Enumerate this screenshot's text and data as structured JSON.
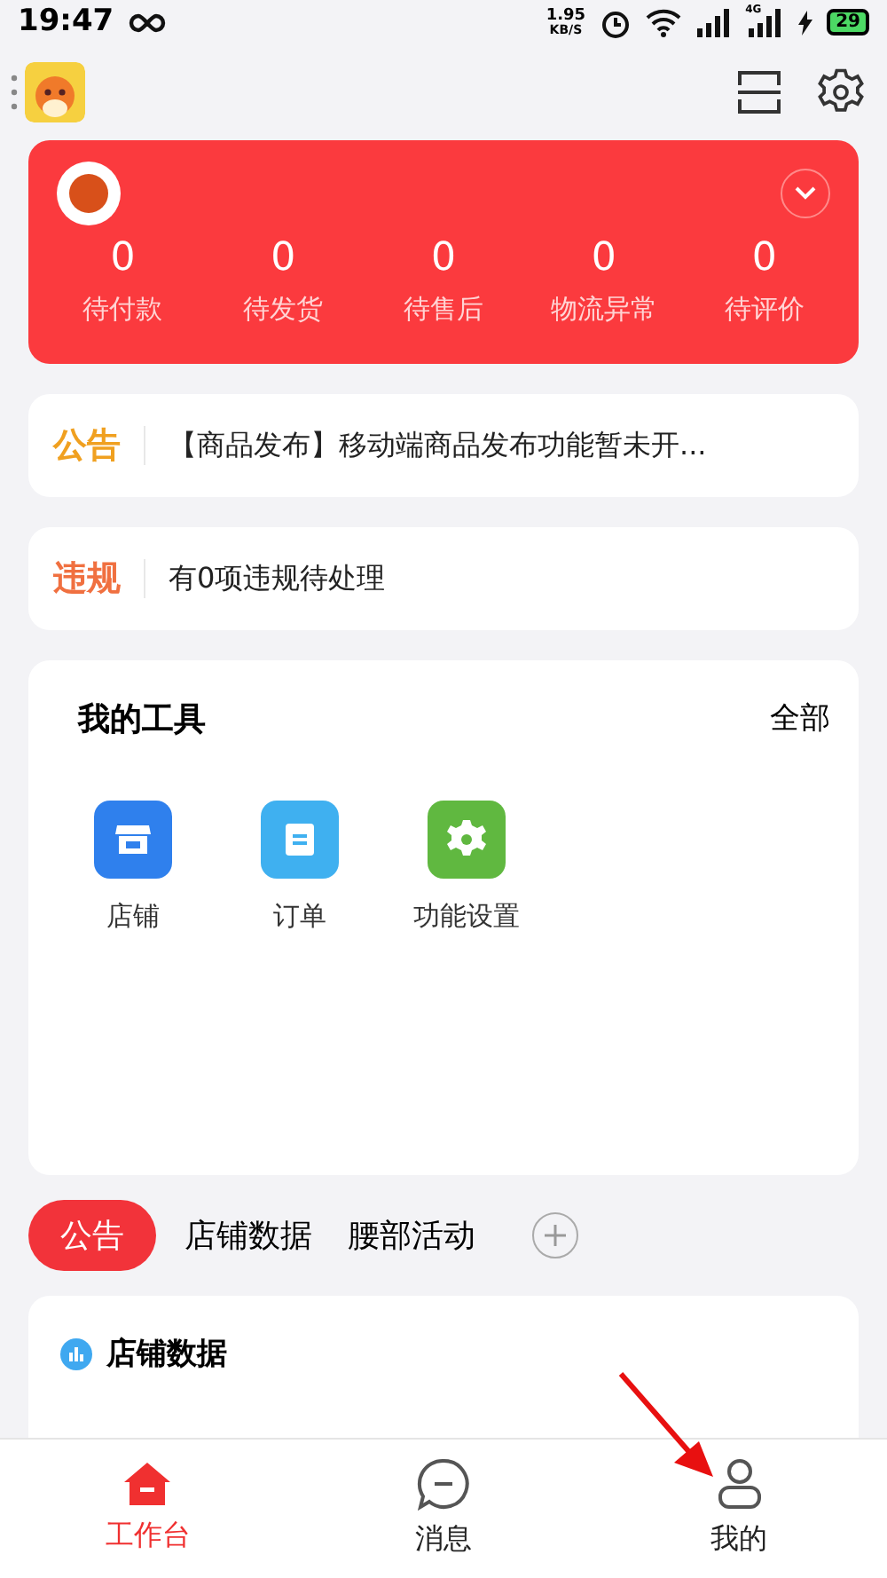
{
  "status_bar": {
    "time": "19:47",
    "speed": "1.95",
    "speed_unit": "KB/S",
    "network": "4G",
    "battery": "29"
  },
  "order_stats": [
    {
      "count": "0",
      "label": "待付款"
    },
    {
      "count": "0",
      "label": "待发货"
    },
    {
      "count": "0",
      "label": "待售后"
    },
    {
      "count": "0",
      "label": "物流异常"
    },
    {
      "count": "0",
      "label": "待评价"
    }
  ],
  "notices": [
    {
      "tag": "公告",
      "color": "#f0a020",
      "text": "【商品发布】移动端商品发布功能暂未开..."
    },
    {
      "tag": "违规",
      "color": "#f07040",
      "text": "有0项违规待处理"
    }
  ],
  "tools": {
    "title": "我的工具",
    "more": "全部",
    "items": [
      {
        "kind": "store",
        "label": "店铺",
        "color": "#2f80ed"
      },
      {
        "kind": "order",
        "label": "订单",
        "color": "#3fb0f0"
      },
      {
        "kind": "settings",
        "label": "功能设置",
        "color": "#60b840"
      }
    ]
  },
  "tabs": [
    {
      "label": "公告",
      "selected": true
    },
    {
      "label": "店铺数据",
      "selected": false
    },
    {
      "label": "腰部活动",
      "selected": false
    }
  ],
  "data_card": {
    "title": "店铺数据"
  },
  "bottom_nav": [
    {
      "kind": "home",
      "label": "工作台",
      "selected": true
    },
    {
      "kind": "message",
      "label": "消息",
      "selected": false
    },
    {
      "kind": "profile",
      "label": "我的",
      "selected": false
    }
  ]
}
